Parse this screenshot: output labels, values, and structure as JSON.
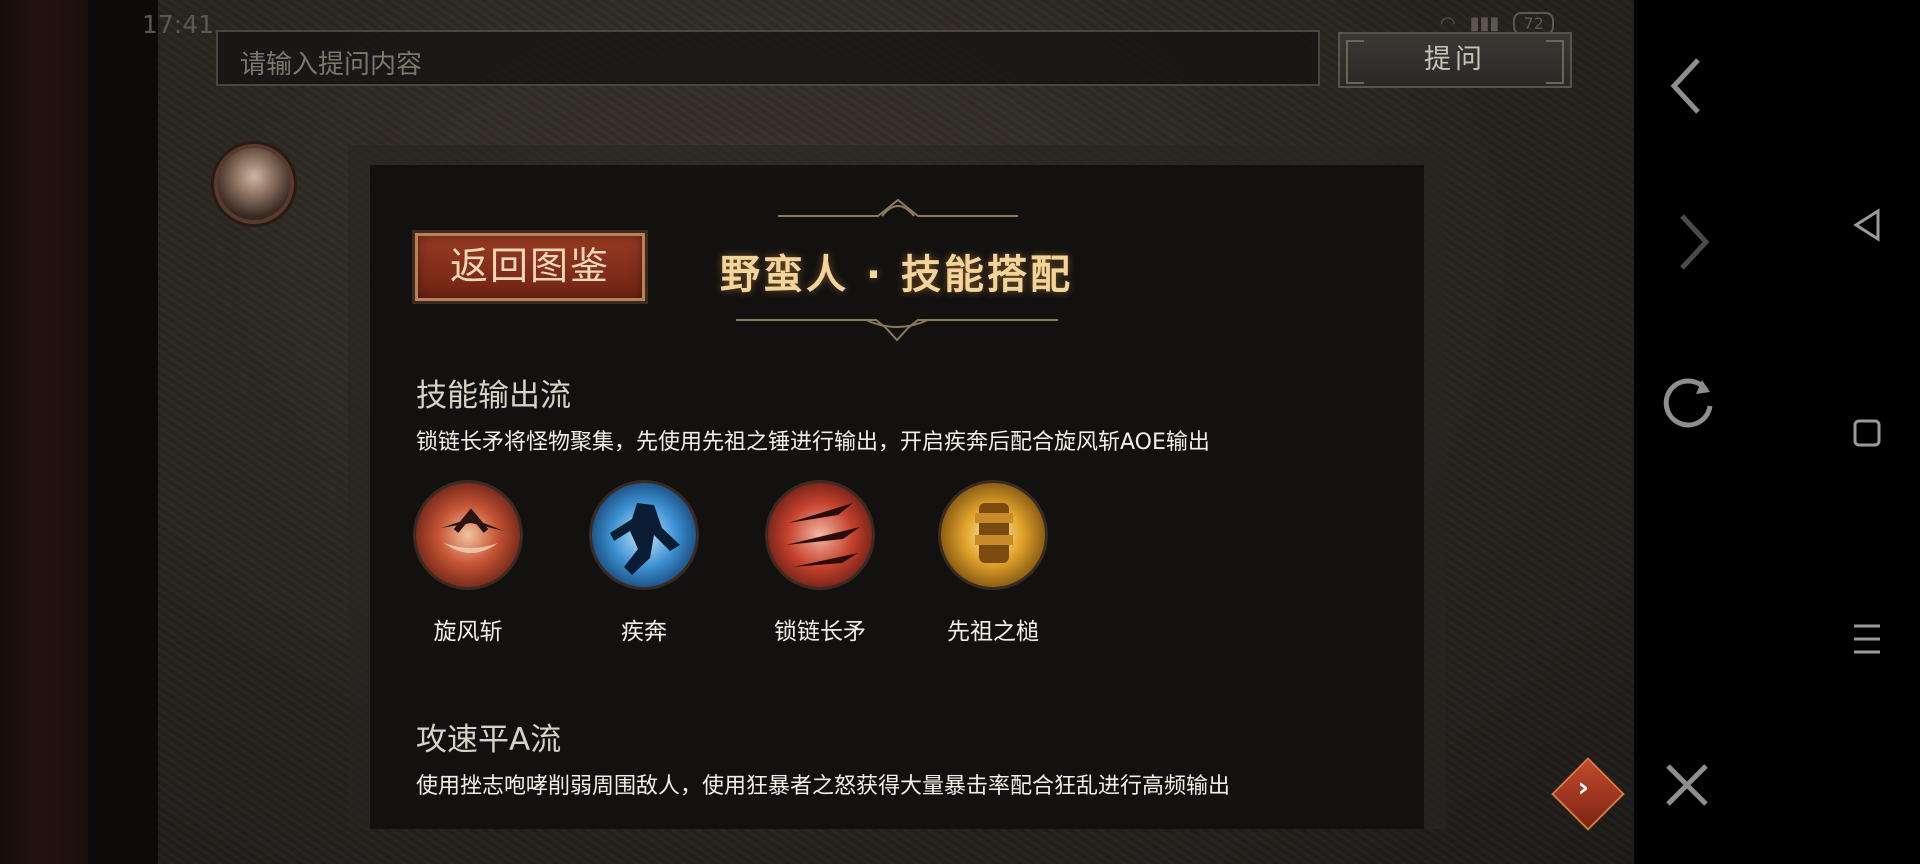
{
  "status_bar": {
    "time": "17:41",
    "battery": "72"
  },
  "search": {
    "placeholder": "请输入提问内容",
    "ask_label": "提问"
  },
  "panel": {
    "back_label": "返回图鉴",
    "title": "野蛮人 · 技能搭配",
    "sections": [
      {
        "title": "技能输出流",
        "desc": "锁链长矛将怪物聚集，先使用先祖之锤进行输出，开启疾奔后配合旋风斩AOE输出",
        "skills": [
          {
            "name": "旋风斩",
            "icon": "whirlwind-icon"
          },
          {
            "name": "疾奔",
            "icon": "sprint-icon"
          },
          {
            "name": "锁链长矛",
            "icon": "chain-spear-icon"
          },
          {
            "name": "先祖之槌",
            "icon": "ancestral-hammer-icon"
          }
        ]
      },
      {
        "title": "攻速平A流",
        "desc": "使用挫志咆哮削弱周围敌人，使用狂暴者之怒获得大量暴击率配合狂乱进行高频输出"
      }
    ]
  },
  "colors": {
    "accent": "#9a3b24",
    "title_gold": "#f3d49a",
    "panel_bg": "#121110"
  }
}
